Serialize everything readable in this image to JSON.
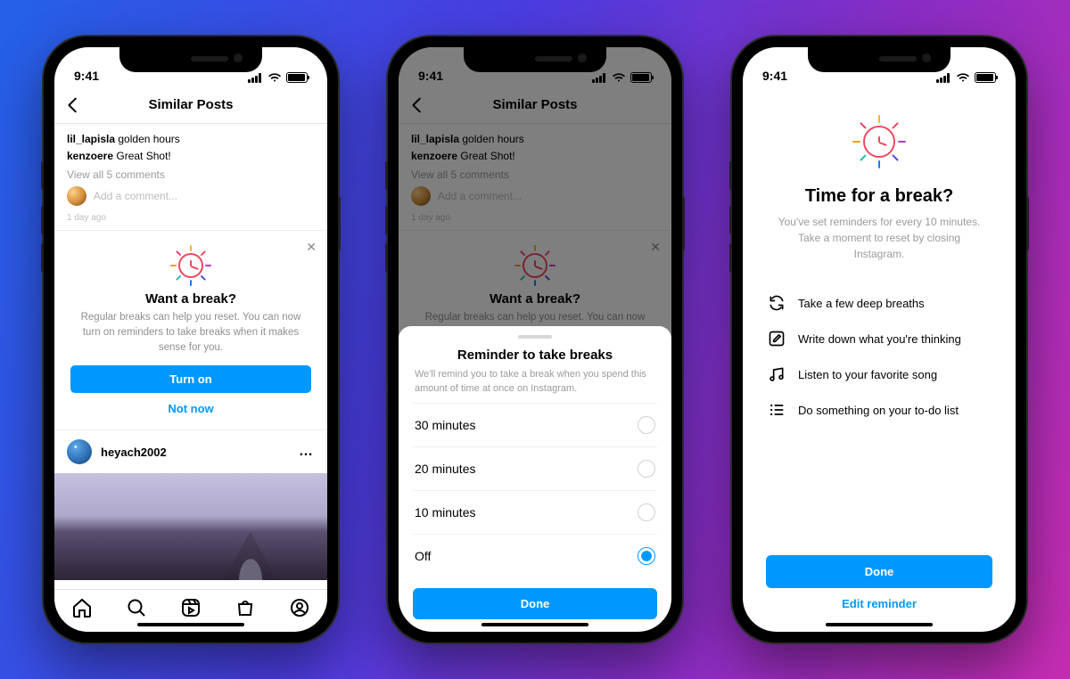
{
  "status": {
    "time": "9:41"
  },
  "header": {
    "title": "Similar Posts"
  },
  "post": {
    "comments": [
      {
        "user": "lil_lapisla",
        "text": "golden hours"
      },
      {
        "user": "kenzoere",
        "text": "Great Shot!"
      }
    ],
    "view_all": "View all 5 comments",
    "add_placeholder": "Add a comment...",
    "age": "1 day ago",
    "next_user": "heyach2002"
  },
  "promo": {
    "title": "Want a break?",
    "body": "Regular breaks can help you reset. You can now turn on reminders to take breaks when it makes sense for you.",
    "primary": "Turn on",
    "secondary": "Not now"
  },
  "sheet": {
    "title": "Reminder to take breaks",
    "sub": "We'll remind you to take a break when you spend this amount of time at once on Instagram.",
    "options": [
      "30 minutes",
      "20 minutes",
      "10 minutes",
      "Off"
    ],
    "selected": 3,
    "done": "Done"
  },
  "break": {
    "title": "Time for a break?",
    "sub": "You've set reminders for every 10 minutes. Take a moment to reset by closing Instagram.",
    "tips": [
      "Take a few deep breaths",
      "Write down what you're thinking",
      "Listen to your favorite song",
      "Do something on your to-do list"
    ],
    "done": "Done",
    "edit": "Edit reminder"
  },
  "colors": {
    "accent": "#0098fd",
    "rays": [
      "#f7b42c",
      "#f0485e",
      "#b53fc1",
      "#5546d8",
      "#1f7af5",
      "#21c2a1",
      "#f79e1b",
      "#ef3e6a"
    ]
  }
}
